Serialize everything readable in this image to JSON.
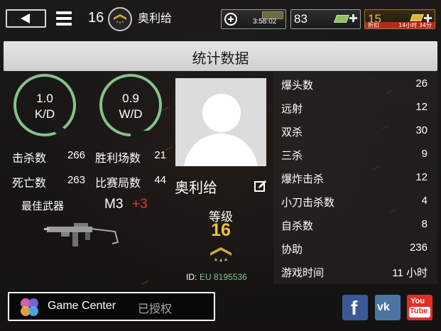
{
  "topbar": {
    "rank_number": "16",
    "player_name": "奥利给",
    "timer": "3:58:02",
    "cash": "83",
    "gold": "15",
    "discount_label": "折扣",
    "discount_time": "14小时 34分"
  },
  "header": {
    "title": "统计数据"
  },
  "left": {
    "kd_value": "1.0",
    "kd_label": "K/D",
    "wd_value": "0.9",
    "wd_label": "W/D",
    "kills_label": "击杀数",
    "kills_value": "266",
    "wins_label": "胜利场数",
    "wins_value": "21",
    "deaths_label": "死亡数",
    "deaths_value": "263",
    "matches_label": "比赛局数",
    "matches_value": "44",
    "best_weapon_label": "最佳武器",
    "best_weapon_name": "M3",
    "best_weapon_level": "+3"
  },
  "profile": {
    "name": "奥利给",
    "level_label": "等级",
    "level_value": "16",
    "id_label": "ID:",
    "id_value": "EU 8195536"
  },
  "stats": [
    {
      "label": "爆头数",
      "value": "26"
    },
    {
      "label": "远射",
      "value": "12"
    },
    {
      "label": "双杀",
      "value": "30"
    },
    {
      "label": "三杀",
      "value": "9"
    },
    {
      "label": "爆炸击杀",
      "value": "12"
    },
    {
      "label": "小刀击杀数",
      "value": "4"
    },
    {
      "label": "自杀数",
      "value": "8"
    },
    {
      "label": "协助",
      "value": "236"
    },
    {
      "label": "游戏时间",
      "value": "11 小时"
    }
  ],
  "bottom": {
    "gc_title": "Game Center",
    "gc_status": "已授权",
    "fb_glyph": "f",
    "vk_glyph": "vk",
    "yt_you": "You",
    "yt_tube": "Tube"
  },
  "colors": {
    "accent_green": "#86c28c",
    "gold": "#f0c040",
    "red": "#e7343a",
    "header_bg": "#d9d9d9"
  }
}
